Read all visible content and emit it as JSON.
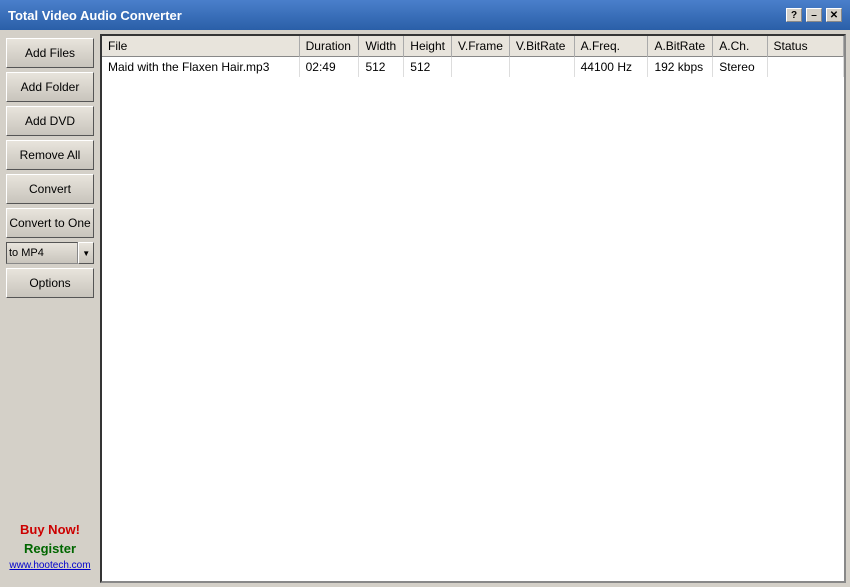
{
  "titleBar": {
    "title": "Total Video Audio Converter",
    "helpBtn": "?",
    "minimizeBtn": "–",
    "closeBtn": "✕"
  },
  "sidebar": {
    "addFilesBtn": "Add Files",
    "addFolderBtn": "Add Folder",
    "addDvdBtn": "Add DVD",
    "removeAllBtn": "Remove All",
    "convertBtn": "Convert",
    "convertToOneBtn": "Convert to One",
    "formatValue": "to MP4",
    "optionsBtn": "Options",
    "buyNow": "Buy Now!",
    "register": "Register",
    "website": "www.hootech.com"
  },
  "table": {
    "columns": [
      {
        "label": "File",
        "key": "file"
      },
      {
        "label": "Duration",
        "key": "duration"
      },
      {
        "label": "Width",
        "key": "width"
      },
      {
        "label": "Height",
        "key": "height"
      },
      {
        "label": "V.Frame",
        "key": "vframe"
      },
      {
        "label": "V.BitRate",
        "key": "vbitrate"
      },
      {
        "label": "A.Freq.",
        "key": "afreq"
      },
      {
        "label": "A.BitRate",
        "key": "abitrate"
      },
      {
        "label": "A.Ch.",
        "key": "ach"
      },
      {
        "label": "Status",
        "key": "status"
      }
    ],
    "rows": [
      {
        "file": "Maid with the Flaxen Hair.mp3",
        "duration": "02:49",
        "width": "512",
        "height": "512",
        "vframe": "",
        "vbitrate": "",
        "afreq": "44100 Hz",
        "abitrate": "192 kbps",
        "ach": "Stereo",
        "status": ""
      }
    ]
  }
}
